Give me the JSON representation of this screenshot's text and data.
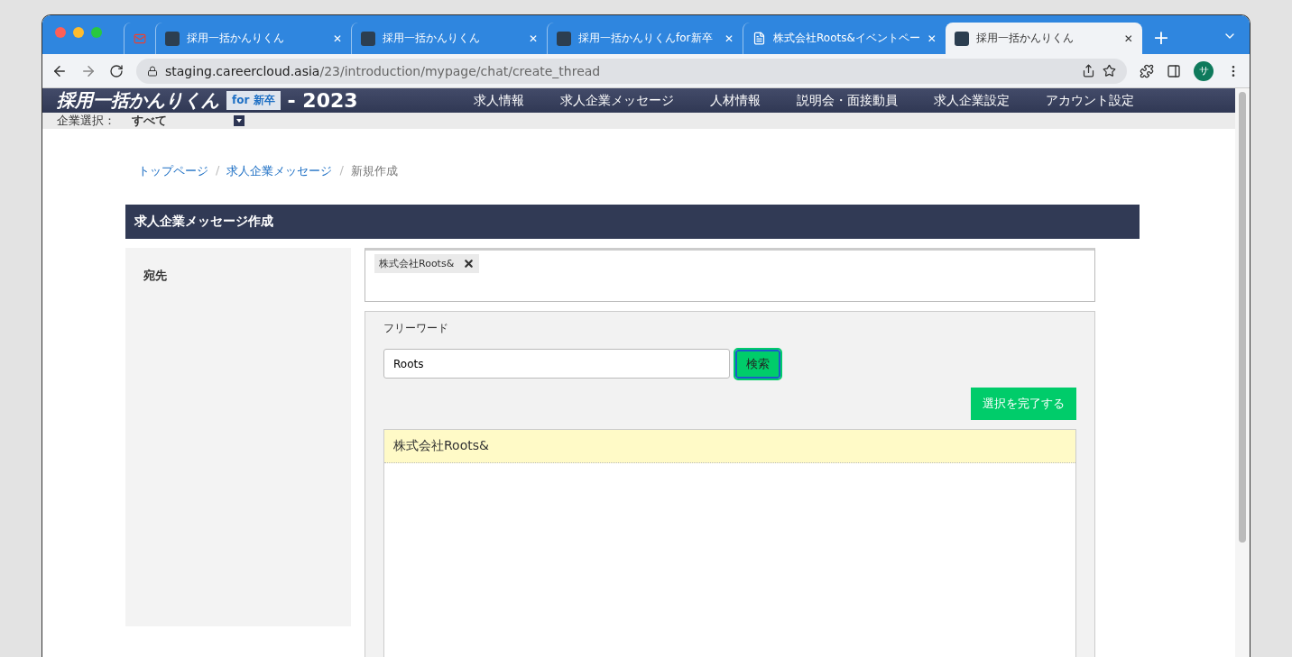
{
  "browser": {
    "tabs": [
      {
        "kind": "mail",
        "selected": false
      },
      {
        "kind": "site",
        "title": "採用一括かんりくん",
        "selected": false
      },
      {
        "kind": "site",
        "title": "採用一括かんりくん",
        "selected": false
      },
      {
        "kind": "site",
        "title": "採用一括かんりくんfor新卒",
        "selected": false
      },
      {
        "kind": "doc",
        "title": "株式会社Roots&イベントペー",
        "selected": false
      },
      {
        "kind": "site",
        "title": "採用一括かんりくん",
        "selected": true
      }
    ],
    "close_glyph": "✕",
    "new_tab_glyph": "+",
    "url_host": "staging.careercloud.asia",
    "url_path": "/23/introduction/mypage/chat/create_thread",
    "profile_initial": "サ"
  },
  "header": {
    "logo_main": "採用一括かんりくん",
    "logo_badge_for": "for",
    "logo_badge": "新卒",
    "logo_year": "- 2023",
    "nav": [
      "求人情報",
      "求人企業メッセージ",
      "人材情報",
      "説明会・面接動員",
      "求人企業設定",
      "アカウント設定"
    ]
  },
  "company_bar": {
    "label": "企業選択：",
    "value": "すべて"
  },
  "breadcrumb": [
    {
      "label": "トップページ",
      "kind": "link"
    },
    {
      "label": "求人企業メッセージ",
      "kind": "link"
    },
    {
      "label": "新規作成",
      "kind": "current"
    }
  ],
  "breadcrumb_separator": "/",
  "section_title": "求人企業メッセージ作成",
  "form": {
    "label": "宛先",
    "chips": [
      {
        "label": "株式会社Roots&"
      }
    ],
    "search_label": "フリーワード",
    "search_value": "Roots",
    "search_button": "検索",
    "complete_button": "選択を完了する",
    "results": [
      {
        "name": "株式会社Roots&",
        "selected": true
      }
    ]
  }
}
